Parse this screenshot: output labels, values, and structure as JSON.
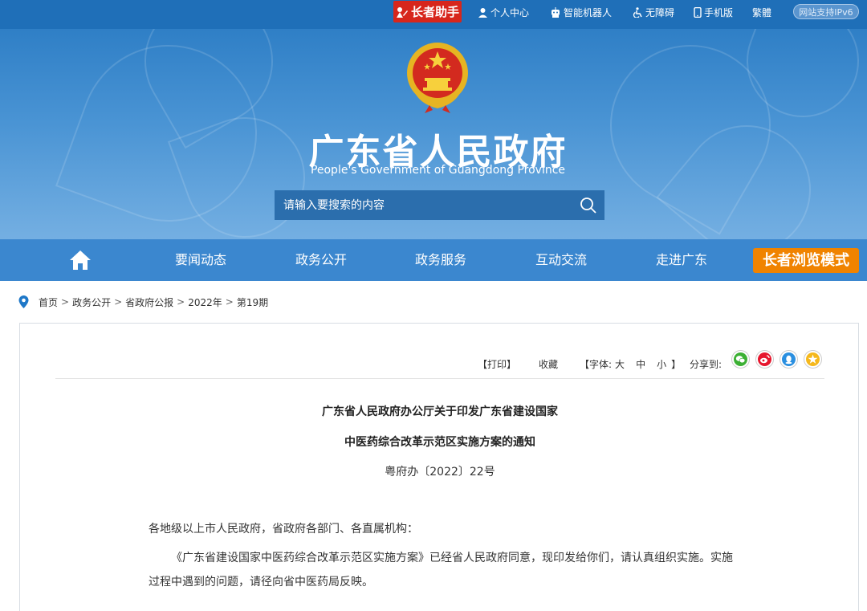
{
  "topbar": {
    "elder_assistant": "长者助手",
    "links": [
      {
        "icon": "person-icon",
        "label": "个人中心"
      },
      {
        "icon": "robot-icon",
        "label": "智能机器人"
      },
      {
        "icon": "accessibility-icon",
        "label": "无障碍"
      },
      {
        "icon": "mobile-icon",
        "label": "手机版"
      },
      {
        "icon": "",
        "label": "繁體"
      }
    ],
    "ipv6": "网站支持IPv6"
  },
  "header": {
    "title": "广东省人民政府",
    "subtitle": "People's Government of Guangdong Province",
    "search_placeholder": "请输入要搜索的内容"
  },
  "nav": {
    "items": [
      "要闻动态",
      "政务公开",
      "政务服务",
      "互动交流",
      "走进广东"
    ],
    "elder_mode": "长者浏览模式"
  },
  "breadcrumb": [
    "首页",
    "政务公开",
    "省政府公报",
    "2022年",
    "第19期"
  ],
  "breadcrumb_sep": ">",
  "tools": {
    "print": "【打印】",
    "favorite": "收藏",
    "font_label": "【字体:",
    "font_large": "大",
    "font_medium": "中",
    "font_small": "小",
    "font_close": "】",
    "share_label": "分享到:"
  },
  "document": {
    "title_line1": "广东省人民政府办公厅关于印发广东省建设国家",
    "title_line2": "中医药综合改革示范区实施方案的通知",
    "doc_number": "粤府办〔2022〕22号",
    "salutation": "各地级以上市人民政府，省政府各部门、各直属机构：",
    "body_line1": "《广东省建设国家中医药综合改革示范区实施方案》已经省人民政府同意，现印发给你们，请认真组织实施。实施",
    "body_line2": "过程中遇到的问题，请径向省中医药局反映。"
  },
  "colors": {
    "topbar": "#1f6fb8",
    "nav": "#3b87cf",
    "elder_red": "#d7261c",
    "elder_orange": "#f08300"
  }
}
